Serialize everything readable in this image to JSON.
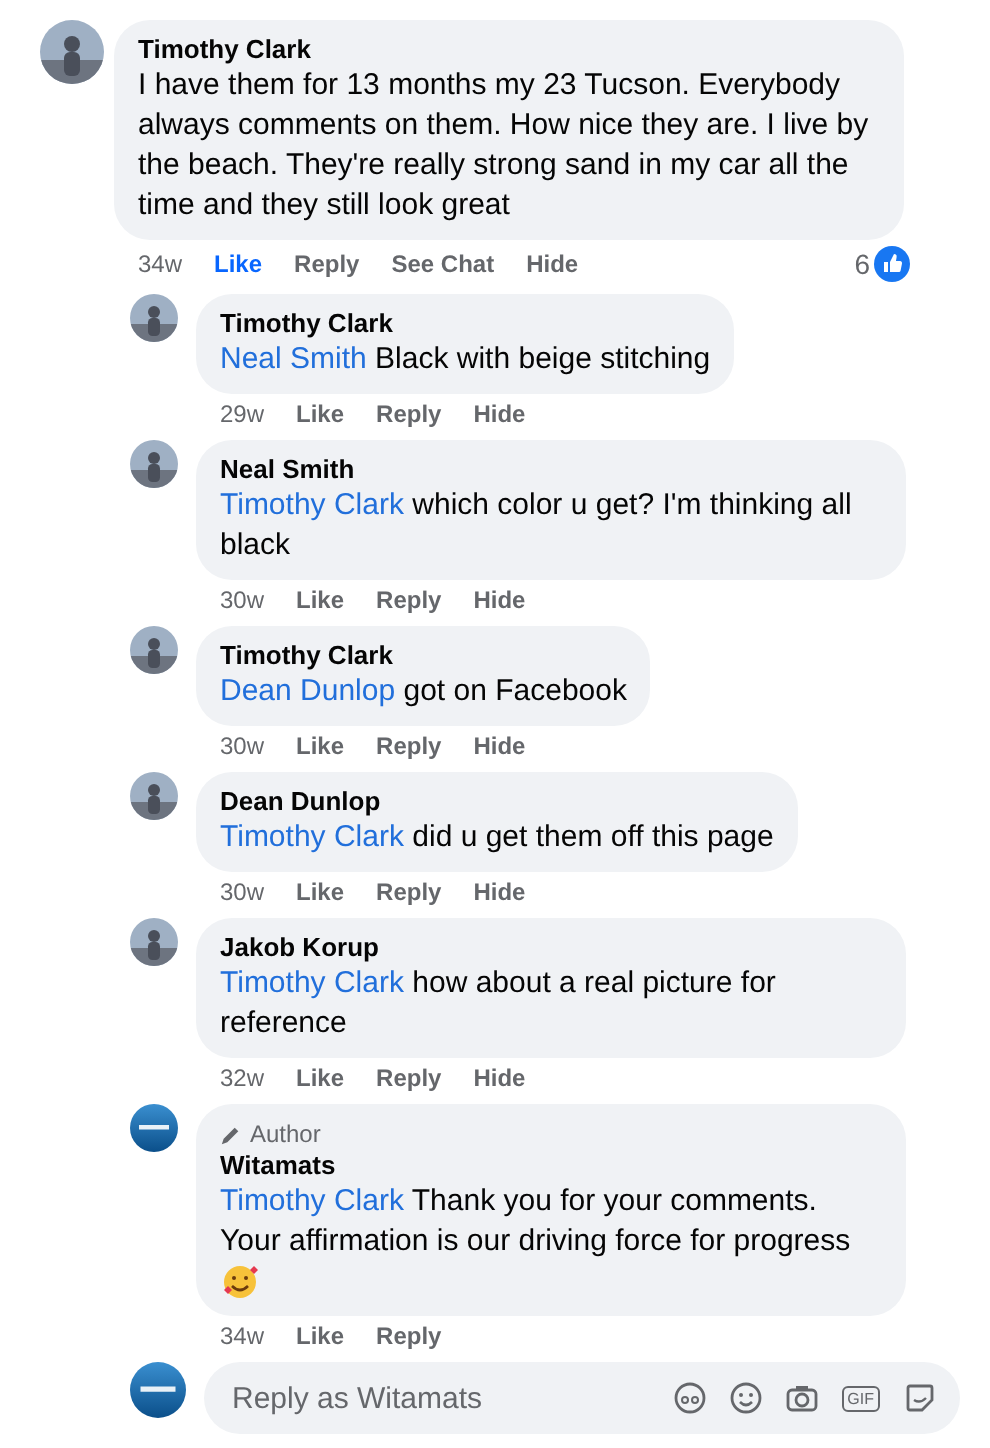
{
  "comment": {
    "author": "Timothy Clark",
    "text": "I have them for 13 months my 23 Tucson. Everybody always comments on them. How nice they are. I live by the beach. They're really strong sand in my car all the time and they still look great",
    "actions": [
      {
        "label": "34w",
        "kind": "time"
      },
      {
        "label": "Like",
        "kind": "action",
        "selected": true
      },
      {
        "label": "Reply",
        "kind": "action",
        "selected": false
      },
      {
        "label": "See Chat",
        "kind": "action",
        "selected": false
      },
      {
        "label": "Hide",
        "kind": "action",
        "selected": false
      }
    ],
    "reactions": "6"
  },
  "replies": [
    {
      "author": "Timothy Clark",
      "mention": "Neal Smith",
      "text": "Black with beige stitching",
      "actions": [
        {
          "label": "29w",
          "kind": "time"
        },
        {
          "label": "Like",
          "kind": "action",
          "selected": false
        },
        {
          "label": "Reply",
          "kind": "action",
          "selected": false
        },
        {
          "label": "Hide",
          "kind": "action",
          "selected": false
        }
      ]
    },
    {
      "author": "Neal Smith",
      "mention": "Timothy Clark",
      "text": "which color u get? I'm thinking all black",
      "actions": [
        {
          "label": "30w",
          "kind": "time"
        },
        {
          "label": "Like",
          "kind": "action",
          "selected": false
        },
        {
          "label": "Reply",
          "kind": "action",
          "selected": false
        },
        {
          "label": "Hide",
          "kind": "action",
          "selected": false
        }
      ]
    },
    {
      "author": "Timothy Clark",
      "mention": "Dean Dunlop",
      "text": "got on Facebook",
      "actions": [
        {
          "label": "30w",
          "kind": "time"
        },
        {
          "label": "Like",
          "kind": "action",
          "selected": false
        },
        {
          "label": "Reply",
          "kind": "action",
          "selected": false
        },
        {
          "label": "Hide",
          "kind": "action",
          "selected": false
        }
      ]
    },
    {
      "author": "Dean Dunlop",
      "mention": "Timothy Clark",
      "text": "did u get them off this page",
      "actions": [
        {
          "label": "30w",
          "kind": "time"
        },
        {
          "label": "Like",
          "kind": "action",
          "selected": false
        },
        {
          "label": "Reply",
          "kind": "action",
          "selected": false
        },
        {
          "label": "Hide",
          "kind": "action",
          "selected": false
        }
      ]
    },
    {
      "author": "Jakob Korup",
      "mention": "Timothy Clark",
      "text": "how about a real picture for reference",
      "actions": [
        {
          "label": "32w",
          "kind": "time"
        },
        {
          "label": "Like",
          "kind": "action",
          "selected": false
        },
        {
          "label": "Reply",
          "kind": "action",
          "selected": false
        },
        {
          "label": "Hide",
          "kind": "action",
          "selected": false
        }
      ]
    },
    {
      "author": "Witamats",
      "badge": "Author",
      "mention": "Timothy Clark",
      "text": "Thank you for your comments. Your affirmation is our driving force for progress",
      "emoji": true,
      "actions": [
        {
          "label": "34w",
          "kind": "time"
        },
        {
          "label": "Like",
          "kind": "action",
          "selected": false
        },
        {
          "label": "Reply",
          "kind": "action",
          "selected": false
        }
      ]
    }
  ],
  "composer": {
    "placeholder": "Reply as Witamats",
    "gif_label": "GIF"
  }
}
